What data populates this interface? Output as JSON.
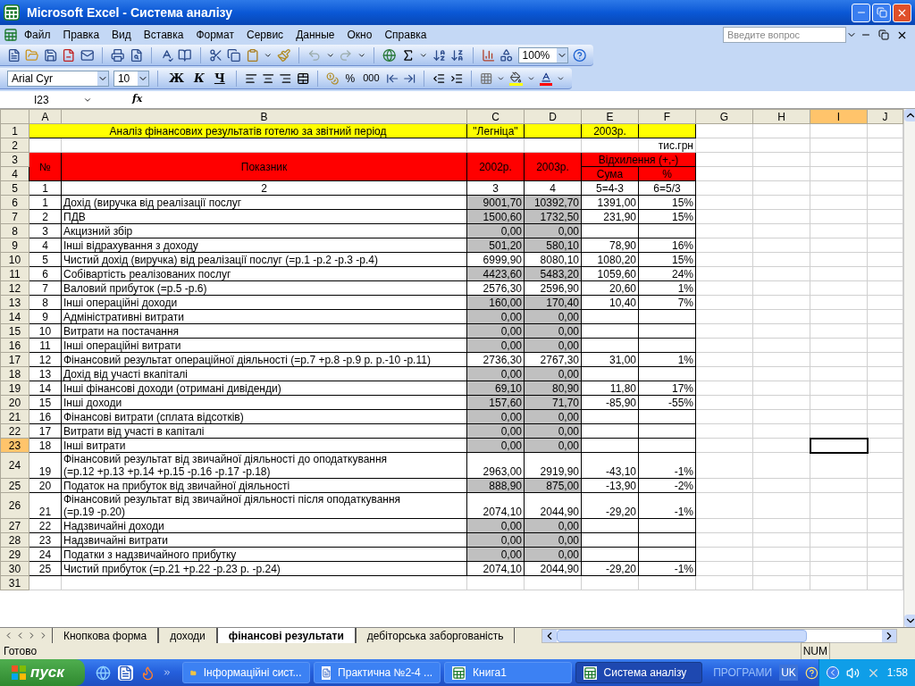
{
  "window": {
    "title": "Microsoft Excel - Система аналізу"
  },
  "menu": [
    "Файл",
    "Правка",
    "Вид",
    "Вставка",
    "Формат",
    "Сервис",
    "Данные",
    "Окно",
    "Справка"
  ],
  "help_search": {
    "placeholder": "Введите вопрос"
  },
  "standard_toolbar": {
    "zoom": "100%"
  },
  "formatting_toolbar": {
    "font": "Arial Cyr",
    "size": "10",
    "bold": "Ж",
    "italic": "К",
    "underline": "Ч",
    "percent": "%",
    "thousands": "000"
  },
  "formula_bar": {
    "name_box": "I23",
    "fx": "fx"
  },
  "columns": [
    {
      "label": "A",
      "selected": false
    },
    {
      "label": "B",
      "selected": false
    },
    {
      "label": "C",
      "selected": false
    },
    {
      "label": "D",
      "selected": false
    },
    {
      "label": "E",
      "selected": false
    },
    {
      "label": "F",
      "selected": false
    },
    {
      "label": "G",
      "selected": false
    },
    {
      "label": "H",
      "selected": false
    },
    {
      "label": "I",
      "selected": true
    },
    {
      "label": "J",
      "selected": false
    }
  ],
  "row_numbers": [
    {
      "num": "1",
      "selected": false
    },
    {
      "num": "2",
      "selected": false
    },
    {
      "num": "3",
      "selected": false
    },
    {
      "num": "4",
      "selected": false
    },
    {
      "num": "5",
      "selected": false
    }
  ],
  "sheet": {
    "title": "Аналіз фінансових результатів готелю за звітний період",
    "hotel": "\"Легніца\"",
    "year": "2003р.",
    "units": "тис.грн",
    "header": {
      "no": "№",
      "indicator": "Показник",
      "y1": "2002р.",
      "y2": "2003р.",
      "deviation": "Відхилення (+,-)",
      "sum": "Сума",
      "pct": "%"
    },
    "index": [
      "1",
      "2",
      "3",
      "4",
      "5=4-3",
      "6=5/3"
    ]
  },
  "rows": [
    {
      "num": "6",
      "selected": false,
      "shaded": true,
      "cells": [
        "1",
        "Дохід (виручка від реалізації послуг",
        "9001,70",
        "10392,70",
        "1391,00",
        "15%"
      ]
    },
    {
      "num": "7",
      "selected": false,
      "shaded": true,
      "cells": [
        "2",
        "ПДВ",
        "1500,60",
        "1732,50",
        "231,90",
        "15%"
      ]
    },
    {
      "num": "8",
      "selected": false,
      "shaded": true,
      "cells": [
        "3",
        "Акцизний збір",
        "0,00",
        "0,00"
      ]
    },
    {
      "num": "9",
      "selected": false,
      "shaded": true,
      "cells": [
        "4",
        "Інші відрахування з доходу",
        "501,20",
        "580,10",
        "78,90",
        "16%"
      ]
    },
    {
      "num": "10",
      "selected": false,
      "shaded": false,
      "cells": [
        "5",
        "Чистий дохід (виручка) від реалізації послуг (=р.1 -р.2 -р.3 -р.4)",
        "6999,90",
        "8080,10",
        "1080,20",
        "15%"
      ]
    },
    {
      "num": "11",
      "selected": false,
      "shaded": true,
      "cells": [
        "6",
        "Собівартість реалізованих послуг",
        "4423,60",
        "5483,20",
        "1059,60",
        "24%"
      ]
    },
    {
      "num": "12",
      "selected": false,
      "shaded": false,
      "cells": [
        "7",
        "Валовий прибуток (=р.5 -р.6)",
        "2576,30",
        "2596,90",
        "20,60",
        "1%"
      ]
    },
    {
      "num": "13",
      "selected": false,
      "shaded": true,
      "cells": [
        "8",
        "Інші операційні доходи",
        "160,00",
        "170,40",
        "10,40",
        "7%"
      ]
    },
    {
      "num": "14",
      "selected": false,
      "shaded": true,
      "cells": [
        "9",
        "Адміністративні витрати",
        "0,00",
        "0,00"
      ]
    },
    {
      "num": "15",
      "selected": false,
      "shaded": true,
      "cells": [
        "10",
        "Витрати на постачання",
        "0,00",
        "0,00"
      ]
    },
    {
      "num": "16",
      "selected": false,
      "shaded": true,
      "cells": [
        "11",
        "Інші операційні витрати",
        "0,00",
        "0,00"
      ]
    },
    {
      "num": "17",
      "selected": false,
      "shaded": false,
      "cells": [
        "12",
        "Фінансовий результат операційної діяльності (=р.7 +р.8 -р.9 р. р.-10 -р.11)",
        "2736,30",
        "2767,30",
        "31,00",
        "1%"
      ]
    },
    {
      "num": "18",
      "selected": false,
      "shaded": true,
      "cells": [
        "13",
        "Дохід від участі вкапіталі",
        "0,00",
        "0,00"
      ]
    },
    {
      "num": "19",
      "selected": false,
      "shaded": true,
      "cells": [
        "14",
        "Інші фінансові доходи (отримані дивіденди)",
        "69,10",
        "80,90",
        "11,80",
        "17%"
      ]
    },
    {
      "num": "20",
      "selected": false,
      "shaded": true,
      "cells": [
        "15",
        "Інші доходи",
        "157,60",
        "71,70",
        "-85,90",
        "-55%"
      ]
    },
    {
      "num": "21",
      "selected": false,
      "shaded": true,
      "cells": [
        "16",
        "Фінансові витрати (сплата відсотків)",
        "0,00",
        "0,00"
      ]
    },
    {
      "num": "22",
      "selected": false,
      "shaded": true,
      "cells": [
        "17",
        "Витрати від участі в капіталі",
        "0,00",
        "0,00"
      ]
    },
    {
      "num": "23",
      "selected": true,
      "shaded": true,
      "cells": [
        "18",
        "Інші витрати",
        "0,00",
        "0,00"
      ]
    },
    {
      "num": "24",
      "selected": false,
      "shaded": false,
      "cells": [
        "19",
        "Фінансовий результат від звичайної діяльності до оподаткування\n(=р.12 +р.13 +р.14 +р.15 -р.16 -р.17 -р.18)",
        "2963,00",
        "2919,90",
        "-43,10",
        "-1%"
      ]
    },
    {
      "num": "25",
      "selected": false,
      "shaded": true,
      "cells": [
        "20",
        "Податок на прибуток від звичайної діяльності",
        "888,90",
        "875,00",
        "-13,90",
        "-2%"
      ]
    },
    {
      "num": "26",
      "selected": false,
      "shaded": false,
      "cells": [
        "21",
        "Фінансовий результат від звичайної діяльності після оподаткування\n(=р.19 -р.20)",
        "2074,10",
        "2044,90",
        "-29,20",
        "-1%"
      ]
    },
    {
      "num": "27",
      "selected": false,
      "shaded": true,
      "cells": [
        "22",
        "Надзвичайні доходи",
        "0,00",
        "0,00"
      ]
    },
    {
      "num": "28",
      "selected": false,
      "shaded": true,
      "cells": [
        "23",
        "Надзвичайні витрати",
        "0,00",
        "0,00"
      ]
    },
    {
      "num": "29",
      "selected": false,
      "shaded": true,
      "cells": [
        "24",
        "Податки з надзвичайного прибутку",
        "0,00",
        "0,00"
      ]
    },
    {
      "num": "30",
      "selected": false,
      "shaded": false,
      "cells": [
        "25",
        "Чистий прибуток (=р.21 +р.22 -р.23 р. -р.24)",
        "2074,10",
        "2044,90",
        "-29,20",
        "-1%"
      ]
    },
    {
      "num": "31",
      "selected": false,
      "shaded": false,
      "cells": []
    }
  ],
  "sheet_tabs": [
    {
      "label": "Кнопкова форма",
      "selected": false
    },
    {
      "label": "доходи",
      "selected": false
    },
    {
      "label": "фінансові результати",
      "selected": true
    },
    {
      "label": "дебіторська заборгованість",
      "selected": false
    }
  ],
  "status_bar": {
    "text": "Готово",
    "num": "NUM"
  },
  "taskbar": {
    "start": "пуск",
    "tasks": [
      {
        "label": "Інформаційні сист...",
        "kind": "folder",
        "selected": false
      },
      {
        "label": "Практична №2-4 ...",
        "kind": "word",
        "selected": false
      },
      {
        "label": "Книга1",
        "kind": "excel",
        "selected": false
      },
      {
        "label": "Система аналізу",
        "kind": "excel",
        "selected": true
      }
    ],
    "programs": "ПРОГРАМИ",
    "lang": "UK",
    "time": "1:58"
  }
}
